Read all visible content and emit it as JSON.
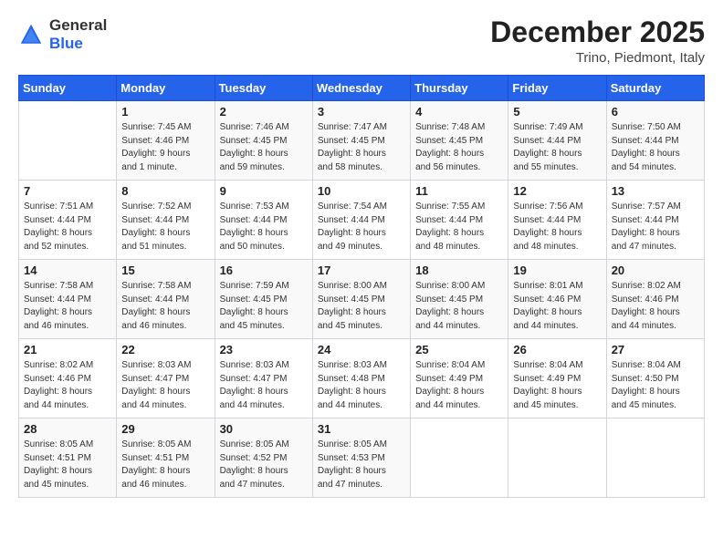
{
  "logo": {
    "general": "General",
    "blue": "Blue"
  },
  "title": "December 2025",
  "location": "Trino, Piedmont, Italy",
  "days_of_week": [
    "Sunday",
    "Monday",
    "Tuesday",
    "Wednesday",
    "Thursday",
    "Friday",
    "Saturday"
  ],
  "weeks": [
    [
      {
        "day": "",
        "info": ""
      },
      {
        "day": "1",
        "info": "Sunrise: 7:45 AM\nSunset: 4:46 PM\nDaylight: 9 hours\nand 1 minute."
      },
      {
        "day": "2",
        "info": "Sunrise: 7:46 AM\nSunset: 4:45 PM\nDaylight: 8 hours\nand 59 minutes."
      },
      {
        "day": "3",
        "info": "Sunrise: 7:47 AM\nSunset: 4:45 PM\nDaylight: 8 hours\nand 58 minutes."
      },
      {
        "day": "4",
        "info": "Sunrise: 7:48 AM\nSunset: 4:45 PM\nDaylight: 8 hours\nand 56 minutes."
      },
      {
        "day": "5",
        "info": "Sunrise: 7:49 AM\nSunset: 4:44 PM\nDaylight: 8 hours\nand 55 minutes."
      },
      {
        "day": "6",
        "info": "Sunrise: 7:50 AM\nSunset: 4:44 PM\nDaylight: 8 hours\nand 54 minutes."
      }
    ],
    [
      {
        "day": "7",
        "info": "Sunrise: 7:51 AM\nSunset: 4:44 PM\nDaylight: 8 hours\nand 52 minutes."
      },
      {
        "day": "8",
        "info": "Sunrise: 7:52 AM\nSunset: 4:44 PM\nDaylight: 8 hours\nand 51 minutes."
      },
      {
        "day": "9",
        "info": "Sunrise: 7:53 AM\nSunset: 4:44 PM\nDaylight: 8 hours\nand 50 minutes."
      },
      {
        "day": "10",
        "info": "Sunrise: 7:54 AM\nSunset: 4:44 PM\nDaylight: 8 hours\nand 49 minutes."
      },
      {
        "day": "11",
        "info": "Sunrise: 7:55 AM\nSunset: 4:44 PM\nDaylight: 8 hours\nand 48 minutes."
      },
      {
        "day": "12",
        "info": "Sunrise: 7:56 AM\nSunset: 4:44 PM\nDaylight: 8 hours\nand 48 minutes."
      },
      {
        "day": "13",
        "info": "Sunrise: 7:57 AM\nSunset: 4:44 PM\nDaylight: 8 hours\nand 47 minutes."
      }
    ],
    [
      {
        "day": "14",
        "info": "Sunrise: 7:58 AM\nSunset: 4:44 PM\nDaylight: 8 hours\nand 46 minutes."
      },
      {
        "day": "15",
        "info": "Sunrise: 7:58 AM\nSunset: 4:44 PM\nDaylight: 8 hours\nand 46 minutes."
      },
      {
        "day": "16",
        "info": "Sunrise: 7:59 AM\nSunset: 4:45 PM\nDaylight: 8 hours\nand 45 minutes."
      },
      {
        "day": "17",
        "info": "Sunrise: 8:00 AM\nSunset: 4:45 PM\nDaylight: 8 hours\nand 45 minutes."
      },
      {
        "day": "18",
        "info": "Sunrise: 8:00 AM\nSunset: 4:45 PM\nDaylight: 8 hours\nand 44 minutes."
      },
      {
        "day": "19",
        "info": "Sunrise: 8:01 AM\nSunset: 4:46 PM\nDaylight: 8 hours\nand 44 minutes."
      },
      {
        "day": "20",
        "info": "Sunrise: 8:02 AM\nSunset: 4:46 PM\nDaylight: 8 hours\nand 44 minutes."
      }
    ],
    [
      {
        "day": "21",
        "info": "Sunrise: 8:02 AM\nSunset: 4:46 PM\nDaylight: 8 hours\nand 44 minutes."
      },
      {
        "day": "22",
        "info": "Sunrise: 8:03 AM\nSunset: 4:47 PM\nDaylight: 8 hours\nand 44 minutes."
      },
      {
        "day": "23",
        "info": "Sunrise: 8:03 AM\nSunset: 4:47 PM\nDaylight: 8 hours\nand 44 minutes."
      },
      {
        "day": "24",
        "info": "Sunrise: 8:03 AM\nSunset: 4:48 PM\nDaylight: 8 hours\nand 44 minutes."
      },
      {
        "day": "25",
        "info": "Sunrise: 8:04 AM\nSunset: 4:49 PM\nDaylight: 8 hours\nand 44 minutes."
      },
      {
        "day": "26",
        "info": "Sunrise: 8:04 AM\nSunset: 4:49 PM\nDaylight: 8 hours\nand 45 minutes."
      },
      {
        "day": "27",
        "info": "Sunrise: 8:04 AM\nSunset: 4:50 PM\nDaylight: 8 hours\nand 45 minutes."
      }
    ],
    [
      {
        "day": "28",
        "info": "Sunrise: 8:05 AM\nSunset: 4:51 PM\nDaylight: 8 hours\nand 45 minutes."
      },
      {
        "day": "29",
        "info": "Sunrise: 8:05 AM\nSunset: 4:51 PM\nDaylight: 8 hours\nand 46 minutes."
      },
      {
        "day": "30",
        "info": "Sunrise: 8:05 AM\nSunset: 4:52 PM\nDaylight: 8 hours\nand 47 minutes."
      },
      {
        "day": "31",
        "info": "Sunrise: 8:05 AM\nSunset: 4:53 PM\nDaylight: 8 hours\nand 47 minutes."
      },
      {
        "day": "",
        "info": ""
      },
      {
        "day": "",
        "info": ""
      },
      {
        "day": "",
        "info": ""
      }
    ]
  ]
}
